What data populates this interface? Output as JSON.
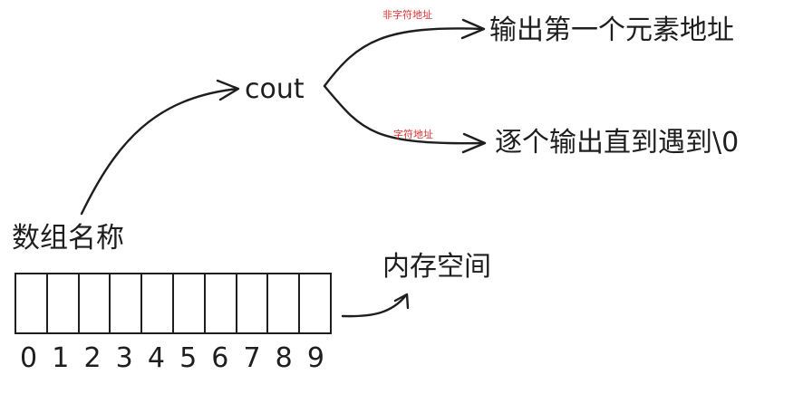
{
  "nodes": {
    "cout": "cout",
    "output_first_address": "输出第一个元素地址",
    "output_until_null": "逐个输出直到遇到\\0",
    "array_name": "数组名称",
    "memory_space": "内存空间"
  },
  "edge_labels": {
    "non_char_address": "非字符地址",
    "char_address": "字符地址"
  },
  "memory": {
    "cell_count": 10,
    "indices": [
      "0",
      "1",
      "2",
      "3",
      "4",
      "5",
      "6",
      "7",
      "8",
      "9"
    ]
  },
  "colors": {
    "stroke": "#1e1e1e",
    "edge_label": "#e03131"
  }
}
